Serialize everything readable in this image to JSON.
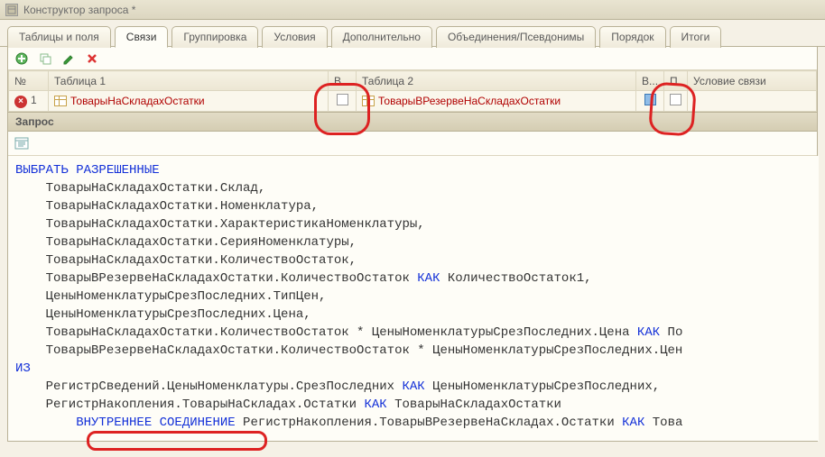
{
  "window": {
    "title": "Конструктор запроса *"
  },
  "tabs": [
    {
      "label": "Таблицы и поля"
    },
    {
      "label": "Связи",
      "active": true
    },
    {
      "label": "Группировка"
    },
    {
      "label": "Условия"
    },
    {
      "label": "Дополнительно"
    },
    {
      "label": "Объединения/Псевдонимы"
    },
    {
      "label": "Порядок"
    },
    {
      "label": "Итоги"
    }
  ],
  "grid": {
    "headers": {
      "num": "№",
      "table1": "Таблица 1",
      "v1": "В...",
      "table2": "Таблица 2",
      "v2": "В...",
      "p": "П.",
      "condition": "Условие связи"
    },
    "rows": [
      {
        "num": "1",
        "table1": "ТоварыНаСкладахОстатки",
        "v1": false,
        "table2": "ТоварыВРезервеНаСкладахОстатки",
        "v2_highlight": true,
        "p": false,
        "condition": ""
      }
    ]
  },
  "section": {
    "label": "Запрос"
  },
  "code": {
    "t01a": "ВЫБРАТЬ ",
    "t01b": "РАЗРЕШЕННЫЕ",
    "t02": "    ТоварыНаСкладахОстатки.Склад,",
    "t03": "    ТоварыНаСкладахОстатки.Номенклатура,",
    "t04": "    ТоварыНаСкладахОстатки.ХарактеристикаНоменклатуры,",
    "t05": "    ТоварыНаСкладахОстатки.СерияНоменклатуры,",
    "t06": "    ТоварыНаСкладахОстатки.КоличествоОстаток,",
    "t07a": "    ТоварыВРезервеНаСкладахОстатки.КоличествоОстаток ",
    "t07b": "КАК",
    "t07c": " КоличествоОстаток1,",
    "t08": "    ЦеныНоменклатурыСрезПоследних.ТипЦен,",
    "t09": "    ЦеныНоменклатурыСрезПоследних.Цена,",
    "t10a": "    ТоварыНаСкладахОстатки.КоличествоОстаток * ЦеныНоменклатурыСрезПоследних.Цена ",
    "t10b": "КАК",
    "t10c": " По",
    "t11": "    ТоварыВРезервеНаСкладахОстатки.КоличествоОстаток * ЦеныНоменклатурыСрезПоследних.Цен",
    "t12": "ИЗ",
    "t13a": "    РегистрСведений.ЦеныНоменклатуры.СрезПоследних ",
    "t13b": "КАК",
    "t13c": " ЦеныНоменклатурыСрезПоследних,",
    "t14a": "    РегистрНакопления.ТоварыНаСкладах.Остатки ",
    "t14b": "КАК",
    "t14c": " ТоварыНаСкладахОстатки",
    "t15a": "        ",
    "t15b": "ВНУТРЕННЕЕ СОЕДИНЕНИЕ",
    "t15c": " РегистрНакопления.ТоварыВРезервеНаСкладах.Остатки ",
    "t15d": "КАК",
    "t15e": " Това"
  },
  "annotations": {
    "a1": "checkbox-v1-circle",
    "a2": "checkbox-v2-circle",
    "a3": "inner-join-underline"
  }
}
